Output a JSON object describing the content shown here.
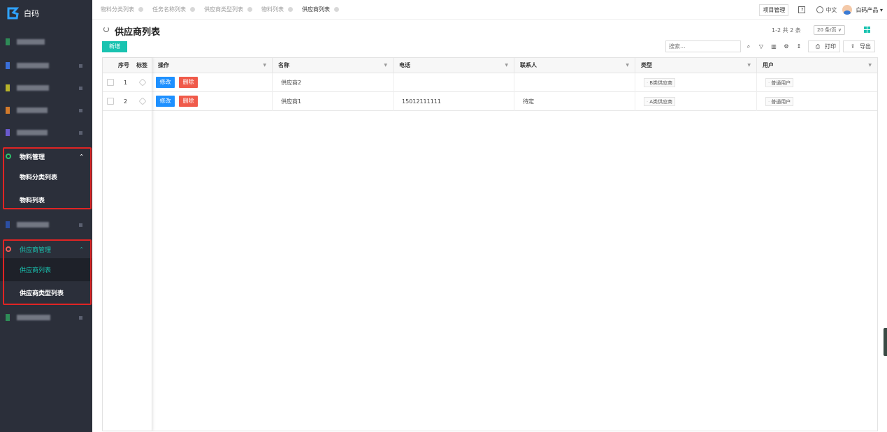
{
  "app": {
    "logo_text": "白码"
  },
  "sidebar": {
    "blurred_rows": [
      {
        "color": "#2e8b57"
      },
      {
        "color": "#3a6fd8"
      },
      {
        "color": "#b7b32a"
      },
      {
        "color": "#d27a2b"
      },
      {
        "color": "#6a5acd"
      },
      {
        "color": "#2c4fa3"
      },
      {
        "color": "#2e8b57"
      }
    ],
    "material_group": {
      "label": "物料管理",
      "items": [
        "物料分类列表",
        "物料列表"
      ]
    },
    "supplier_group": {
      "label": "供应商管理",
      "items": [
        "供应商列表",
        "供应商类型列表"
      ],
      "active_item": "供应商列表"
    }
  },
  "tabs": [
    "物料分类列表",
    "任务名称列表",
    "供应商类型列表",
    "物料列表",
    "供应商列表"
  ],
  "topbar": {
    "project_btn": "项目管理",
    "lang": "中文",
    "user": "白码产品 ▾"
  },
  "page": {
    "title": "供应商列表",
    "pager": "1-2 共 2 条",
    "page_size": "20 条/页 ∨",
    "add_btn": "新增",
    "search_placeholder": "搜索...",
    "print_label": "打印",
    "export_label": "导出"
  },
  "table": {
    "columns": [
      "序号",
      "标签",
      "操作",
      "名称",
      "电话",
      "联系人",
      "类型",
      "用户"
    ],
    "edit_label": "修改",
    "delete_label": "删除",
    "rows": [
      {
        "index": "1",
        "name": "供应商2",
        "phone": "",
        "contact": "",
        "type": "B类供应商",
        "user": "普通用户"
      },
      {
        "index": "2",
        "name": "供应商1",
        "phone": "15012111111",
        "contact": "待定",
        "type": "A类供应商",
        "user": "普通用户"
      }
    ]
  },
  "colors": {
    "accent": "#19c3b0",
    "sidebar_bg": "#2b2f3a",
    "edit": "#1e90ff",
    "delete": "#f05a4a",
    "highlight": "#e02424"
  }
}
